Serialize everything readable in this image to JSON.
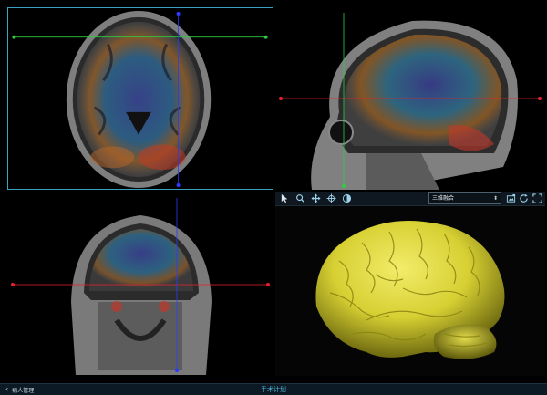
{
  "toolbar3d": {
    "tools": [
      {
        "name": "pointer",
        "icon": "cursor-arrow-icon"
      },
      {
        "name": "zoom",
        "icon": "zoom-icon"
      },
      {
        "name": "pan",
        "icon": "move-arrows-icon"
      },
      {
        "name": "crosshair",
        "icon": "crosshair-icon"
      },
      {
        "name": "contrast",
        "icon": "contrast-icon"
      }
    ],
    "mode_selected": "三维融合",
    "right_tools": [
      {
        "name": "screenshot",
        "icon": "screenshot-icon"
      },
      {
        "name": "reset",
        "icon": "refresh-icon"
      },
      {
        "name": "fullscreen",
        "icon": "fullscreen-icon"
      }
    ]
  },
  "bottombar": {
    "back_label": "病人管理",
    "title": "手术计划"
  },
  "colors": {
    "accent": "#52b6dc",
    "active_border": "#3aa3c4",
    "crosshair_green": "#2ecc40",
    "crosshair_red": "#e8202a",
    "crosshair_blue": "#2a3cff",
    "brain_3d": "#d7d033"
  }
}
